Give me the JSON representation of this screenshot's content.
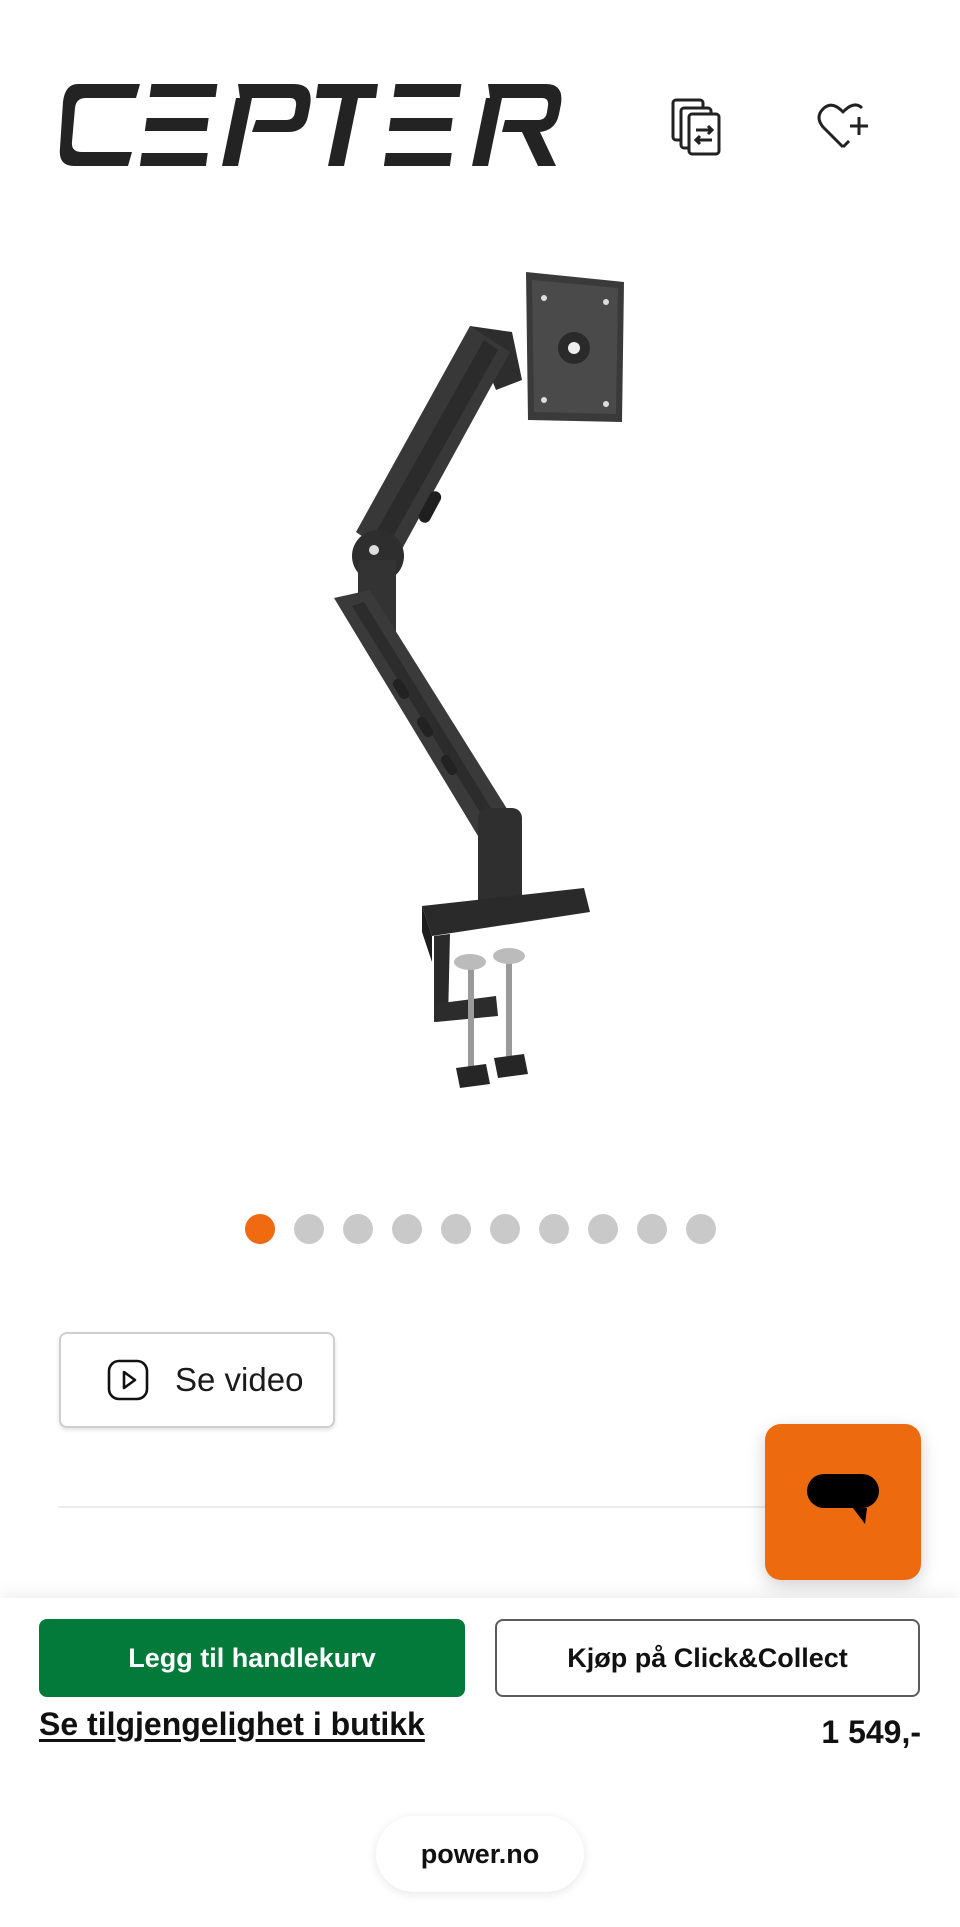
{
  "header": {
    "brand_logo": "CEPTER",
    "compare_icon": "compare-icon",
    "wishlist_icon": "heart-plus-icon"
  },
  "gallery": {
    "image_subject": "monitor-arm",
    "dot_count": 10,
    "active_index": 0
  },
  "video": {
    "label": "Se video",
    "icon": "play-icon"
  },
  "chat": {
    "icon": "chat-bubble-icon"
  },
  "footer": {
    "add_to_cart_label": "Legg til handlekurv",
    "click_collect_label": "Kjøp på Click&Collect",
    "availability_label": "Se tilgjengelighet i butikk",
    "price": "1 549,-"
  },
  "browser": {
    "url": "power.no"
  },
  "colors": {
    "accent_orange": "#ef6a11",
    "primary_green": "#047a3a",
    "dot_inactive": "#c9c9c9"
  }
}
